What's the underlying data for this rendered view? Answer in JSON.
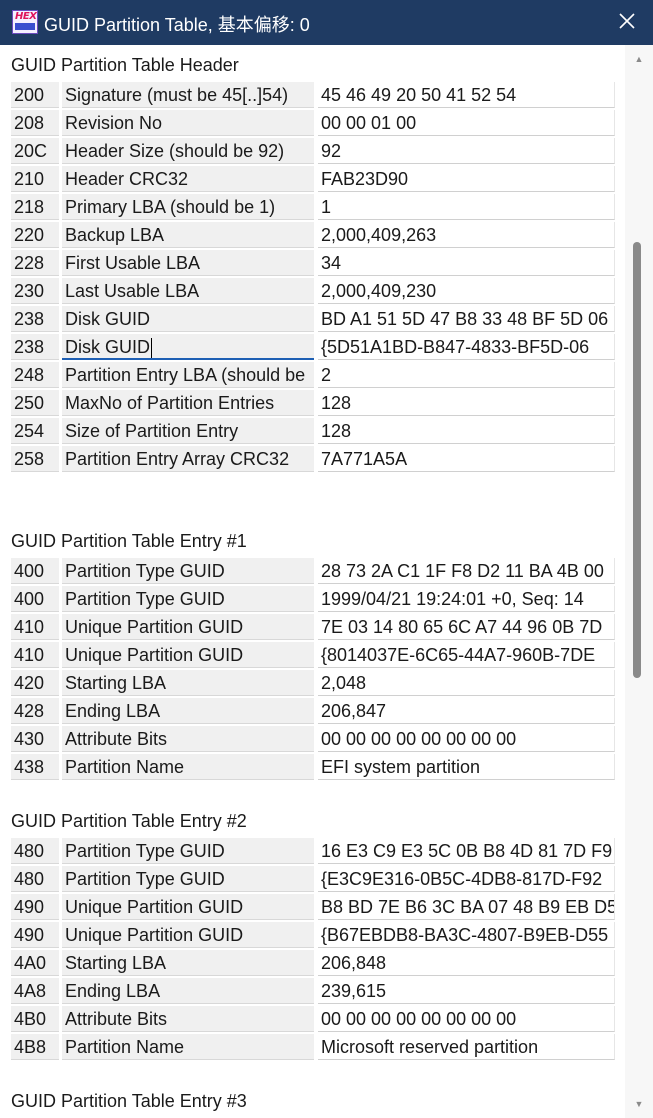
{
  "window": {
    "title": "GUID Partition Table, 基本偏移: 0",
    "icon": "hex-editor-app-icon",
    "close_icon": "close-icon",
    "icon_text": "HEX"
  },
  "header_section": {
    "title": "GUID Partition Table Header",
    "rows": [
      {
        "offset": "200",
        "name": "Signature (must be 45[..]54)",
        "value": "45 46 49 20 50 41 52 54"
      },
      {
        "offset": "208",
        "name": "Revision No",
        "value": "00 00 01 00"
      },
      {
        "offset": "20C",
        "name": "Header Size (should be 92)",
        "value": "92"
      },
      {
        "offset": "210",
        "name": "Header CRC32",
        "value": "FAB23D90"
      },
      {
        "offset": "218",
        "name": "Primary LBA (should be 1)",
        "value": "1"
      },
      {
        "offset": "220",
        "name": "Backup LBA",
        "value": "2,000,409,263"
      },
      {
        "offset": "228",
        "name": "First Usable LBA",
        "value": "34"
      },
      {
        "offset": "230",
        "name": "Last Usable LBA",
        "value": "2,000,409,230"
      },
      {
        "offset": "238",
        "name": "Disk GUID",
        "value": "BD A1 51 5D 47 B8 33 48 BF 5D 06"
      },
      {
        "offset": "238",
        "name": "Disk GUID",
        "value": "{5D51A1BD-B847-4833-BF5D-06"
      },
      {
        "offset": "248",
        "name": "Partition Entry LBA (should be",
        "value": "2"
      },
      {
        "offset": "250",
        "name": "MaxNo of Partition Entries",
        "value": "128"
      },
      {
        "offset": "254",
        "name": "Size of Partition Entry",
        "value": "128"
      },
      {
        "offset": "258",
        "name": "Partition Entry Array CRC32",
        "value": "7A771A5A"
      }
    ]
  },
  "entry1": {
    "title": "GUID Partition Table Entry #1",
    "rows": [
      {
        "offset": "400",
        "name": "Partition Type GUID",
        "value": "28 73 2A C1 1F F8 D2 11 BA 4B 00"
      },
      {
        "offset": "400",
        "name": "Partition Type GUID",
        "value": "1999/04/21  19:24:01  +0, Seq: 14"
      },
      {
        "offset": "410",
        "name": "Unique Partition GUID",
        "value": "7E 03 14 80 65 6C A7 44 96 0B 7D"
      },
      {
        "offset": "410",
        "name": "Unique Partition GUID",
        "value": "{8014037E-6C65-44A7-960B-7DE"
      },
      {
        "offset": "420",
        "name": "Starting LBA",
        "value": "2,048"
      },
      {
        "offset": "428",
        "name": "Ending LBA",
        "value": "206,847"
      },
      {
        "offset": "430",
        "name": "Attribute Bits",
        "value": "00 00 00 00 00 00 00 00"
      },
      {
        "offset": "438",
        "name": "Partition Name",
        "value": "EFI system partition"
      }
    ]
  },
  "entry2": {
    "title": "GUID Partition Table Entry #2",
    "rows": [
      {
        "offset": "480",
        "name": "Partition Type GUID",
        "value": "16 E3 C9 E3 5C 0B B8 4D 81 7D F9"
      },
      {
        "offset": "480",
        "name": "Partition Type GUID",
        "value": "{E3C9E316-0B5C-4DB8-817D-F92"
      },
      {
        "offset": "490",
        "name": "Unique Partition GUID",
        "value": "B8 BD 7E B6 3C BA 07 48 B9 EB D5"
      },
      {
        "offset": "490",
        "name": "Unique Partition GUID",
        "value": "{B67EBDB8-BA3C-4807-B9EB-D55"
      },
      {
        "offset": "4A0",
        "name": "Starting LBA",
        "value": "206,848"
      },
      {
        "offset": "4A8",
        "name": "Ending LBA",
        "value": "239,615"
      },
      {
        "offset": "4B0",
        "name": "Attribute Bits",
        "value": "00 00 00 00 00 00 00 00"
      },
      {
        "offset": "4B8",
        "name": "Partition Name",
        "value": "Microsoft reserved partition"
      }
    ]
  },
  "entry3": {
    "title": "GUID Partition Table Entry #3"
  },
  "colors": {
    "titlebar": "#1f3b63",
    "focus_underline": "#1e5fb4",
    "label_cell_bg": "#f0f0f0"
  }
}
